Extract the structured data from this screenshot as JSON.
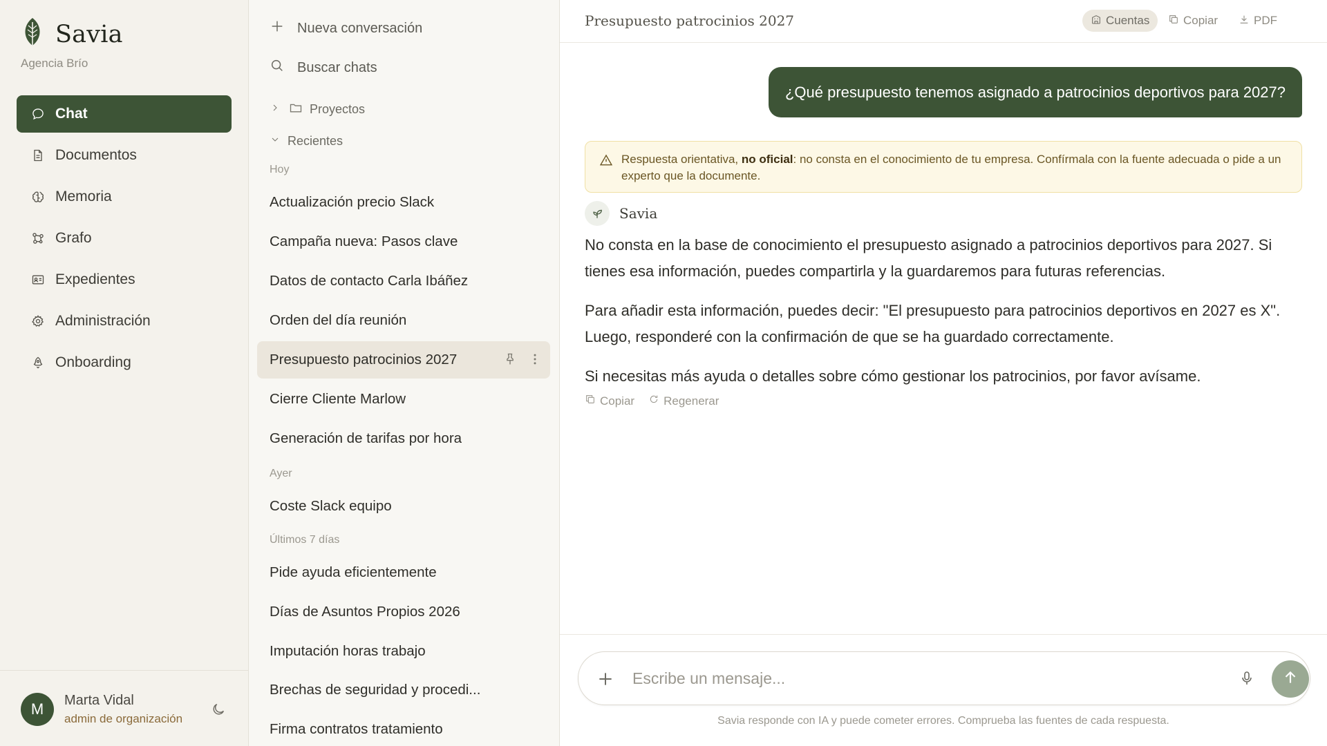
{
  "brand": {
    "name": "Savia",
    "org": "Agencia Brío"
  },
  "nav": {
    "items": [
      {
        "label": "Chat",
        "icon": "chat-bubble-icon",
        "active": true
      },
      {
        "label": "Documentos",
        "icon": "document-icon"
      },
      {
        "label": "Memoria",
        "icon": "brain-icon"
      },
      {
        "label": "Grafo",
        "icon": "graph-icon"
      },
      {
        "label": "Expedientes",
        "icon": "id-card-icon"
      },
      {
        "label": "Administración",
        "icon": "gear-icon"
      },
      {
        "label": "Onboarding",
        "icon": "rocket-icon"
      }
    ]
  },
  "user": {
    "initial": "M",
    "name": "Marta Vidal",
    "role": "admin de organización"
  },
  "list": {
    "new_chat": "Nueva conversación",
    "search": "Buscar chats",
    "projects": "Proyectos",
    "recents": "Recientes",
    "groups": {
      "today": "Hoy",
      "yesterday": "Ayer",
      "last7": "Últimos 7 días"
    },
    "today_chats": [
      "Actualización precio Slack",
      "Campaña nueva: Pasos clave",
      "Datos de contacto Carla Ibáñez",
      "Orden del día reunión",
      "Presupuesto patrocinios 2027",
      "Cierre Cliente Marlow",
      "Generación de tarifas por hora"
    ],
    "yesterday_chats": [
      "Coste Slack equipo"
    ],
    "last7_chats": [
      "Pide ayuda eficientemente",
      "Días de Asuntos Propios 2026",
      "Imputación horas trabajo",
      "Brechas de seguridad y procedi...",
      "Firma contratos tratamiento"
    ]
  },
  "conversation": {
    "title": "Presupuesto patrocinios 2027",
    "toolbar": {
      "accounts": "Cuentas",
      "copy": "Copiar",
      "pdf": "PDF"
    },
    "user_message": "¿Qué presupuesto tenemos asignado a patrocinios deportivos para 2027?",
    "warning": {
      "prefix": "Respuesta orientativa, ",
      "bold": "no oficial",
      "suffix": ": no consta en el conocimiento de tu empresa. Confírmala con la fuente adecuada o pide a un experto que la documente."
    },
    "assistant_name": "Savia",
    "assistant_paragraphs": [
      "No consta en la base de conocimiento el presupuesto asignado a patrocinios deportivos para 2027. Si tienes esa información, puedes compartirla y la guardaremos para futuras referencias.",
      "Para añadir esta información, puedes decir: \"El presupuesto para patrocinios deportivos en 2027 es X\". Luego, responderé con la confirmación de que se ha guardado correctamente.",
      "Si necesitas más ayuda o detalles sobre cómo gestionar los patrocinios, por favor avísame."
    ],
    "actions": {
      "copy": "Copiar",
      "regenerate": "Regenerar"
    }
  },
  "composer": {
    "placeholder": "Escribe un mensaje...",
    "disclaimer": "Savia responde con IA y puede cometer errores. Comprueba las fuentes de cada respuesta."
  }
}
